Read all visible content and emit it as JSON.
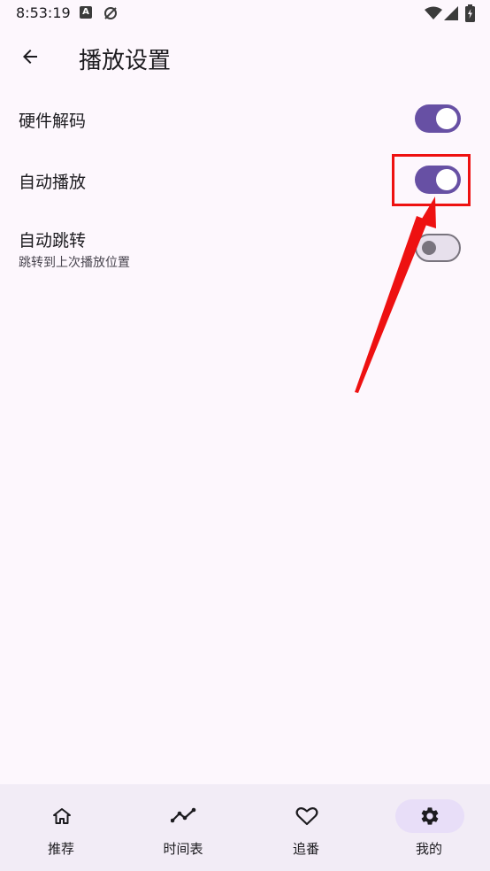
{
  "status_bar": {
    "time": "8:53:19",
    "notification_icons": [
      "accessibility-a-icon",
      "no-sync-icon"
    ],
    "system_icons": [
      "wifi-icon",
      "signal-icon",
      "battery-charging-icon"
    ]
  },
  "app_bar": {
    "back_icon": "arrow-back-icon",
    "title": "播放设置"
  },
  "settings": [
    {
      "id": "hardware-decode",
      "title": "硬件解码",
      "subtitle": "",
      "enabled": true
    },
    {
      "id": "auto-play",
      "title": "自动播放",
      "subtitle": "",
      "enabled": true
    },
    {
      "id": "auto-skip",
      "title": "自动跳转",
      "subtitle": "跳转到上次播放位置",
      "enabled": false
    }
  ],
  "annotation": {
    "color": "#ee1111",
    "target": "auto-play-switch"
  },
  "colors": {
    "accent": "#6750a4",
    "background": "#fdf7fd",
    "nav_background": "#f2ecf6",
    "nav_active_pill": "#e8def8"
  },
  "bottom_nav": {
    "items": [
      {
        "label": "推荐",
        "icon": "home-icon",
        "active": false
      },
      {
        "label": "时间表",
        "icon": "timeline-icon",
        "active": false
      },
      {
        "label": "追番",
        "icon": "heart-icon",
        "active": false
      },
      {
        "label": "我的",
        "icon": "gear-icon",
        "active": true
      }
    ]
  }
}
